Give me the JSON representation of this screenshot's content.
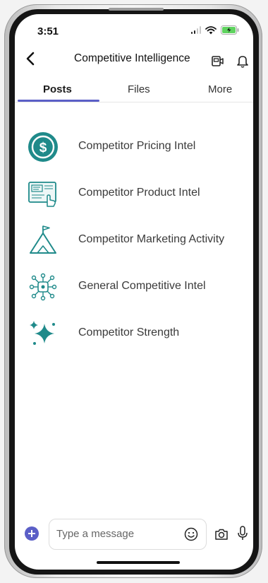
{
  "status_bar": {
    "time": "3:51"
  },
  "header": {
    "title": "Competitive Intelligence"
  },
  "tabs": [
    {
      "label": "Posts",
      "active": true
    },
    {
      "label": "Files",
      "active": false
    },
    {
      "label": "More",
      "active": false
    }
  ],
  "channels": [
    {
      "label": "Competitor Pricing Intel",
      "icon": "dollar-coin-icon"
    },
    {
      "label": "Competitor Product Intel",
      "icon": "product-screen-icon"
    },
    {
      "label": "Competitor Marketing Activity",
      "icon": "mountain-flag-icon"
    },
    {
      "label": "General Competitive Intel",
      "icon": "network-nodes-icon"
    },
    {
      "label": "Competitor Strength",
      "icon": "sparkles-icon"
    }
  ],
  "composer": {
    "placeholder": "Type a message"
  },
  "colors": {
    "accent": "#5b5fc7",
    "icon_teal": "#1f8a8a"
  }
}
